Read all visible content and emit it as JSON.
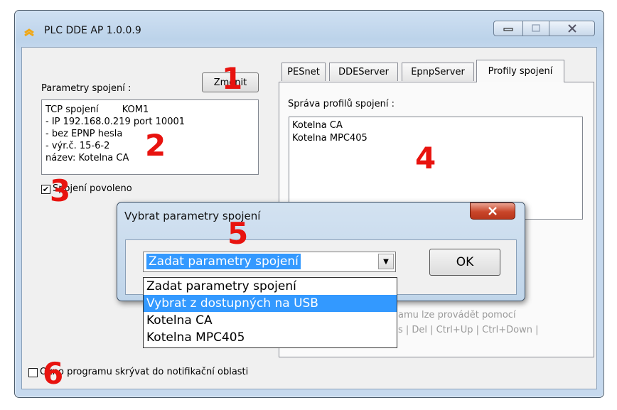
{
  "window": {
    "title": "PLC DDE AP 1.0.0.9"
  },
  "left": {
    "params_label": "Parametry spojení :",
    "change_button": "Změnit",
    "info_lines": [
      "TCP spojení        KOM1",
      "- IP 192.168.0.219 port 10001",
      "- bez EPNP hesla",
      "- výr.č. 15-6-2",
      "název: Kotelna CA"
    ],
    "enabled_label": "Spojení povoleno",
    "enabled_checked": true
  },
  "tabs": [
    "PESnet",
    "DDEServer",
    "EpnpServer",
    "Profily spojení"
  ],
  "active_tab": "Profily spojení",
  "profiles": {
    "label": "Správa profilů spojení :",
    "items": [
      "Kotelna CA",
      "Kotelna MPC405"
    ],
    "hint_lines": [
      "amu lze provádět pomocí",
      "s | Del | Ctrl+Up | Ctrl+Down |"
    ]
  },
  "notif": {
    "label": "Okno programu skrývat do notifikační oblasti",
    "checked": false
  },
  "dialog": {
    "title": "Vybrat parametry spojení",
    "selected_value": "Zadat parametry spojení",
    "ok_label": "OK",
    "options": [
      "Zadat parametry spojení",
      "Vybrat z dostupných na USB",
      "Kotelna CA",
      "Kotelna MPC405"
    ],
    "highlighted_option": "Vybrat z dostupných na USB"
  },
  "annotations": [
    "1",
    "2",
    "3",
    "4",
    "5",
    "6"
  ],
  "colors": {
    "annotation": "#e8130f",
    "selection": "#3399ff"
  }
}
